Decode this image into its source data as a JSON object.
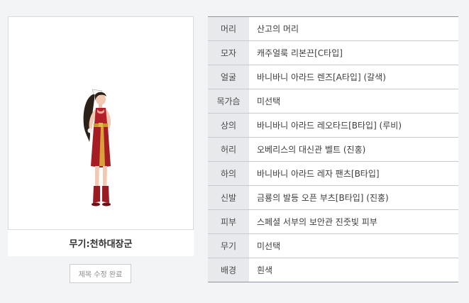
{
  "character": {
    "weapon_caption": "무기:천하대장군",
    "edit_button_label": "제목 수정 완료"
  },
  "equipment": [
    {
      "slot": "머리",
      "item": "산고의 머리"
    },
    {
      "slot": "모자",
      "item": "캐주얼룩 리본끈[C타입]"
    },
    {
      "slot": "얼굴",
      "item": "바니바니 아라드 렌즈[A타입] (갈색)"
    },
    {
      "slot": "목가슴",
      "item": "미선택"
    },
    {
      "slot": "상의",
      "item": "바니바니 아라드 레오타드[B타입] (루비)"
    },
    {
      "slot": "허리",
      "item": "오베리스의 대신관 벨트 (진홍)"
    },
    {
      "slot": "하의",
      "item": "바니바니 아라드 레자 팬츠[B타입]"
    },
    {
      "slot": "신발",
      "item": "금룡의 발등 오픈 부츠[B타입] (진홍)"
    },
    {
      "slot": "피부",
      "item": "스페셜 서부의 보안관 진줏빛 피부"
    },
    {
      "slot": "무기",
      "item": "미선택"
    },
    {
      "slot": "배경",
      "item": "흰색"
    }
  ]
}
